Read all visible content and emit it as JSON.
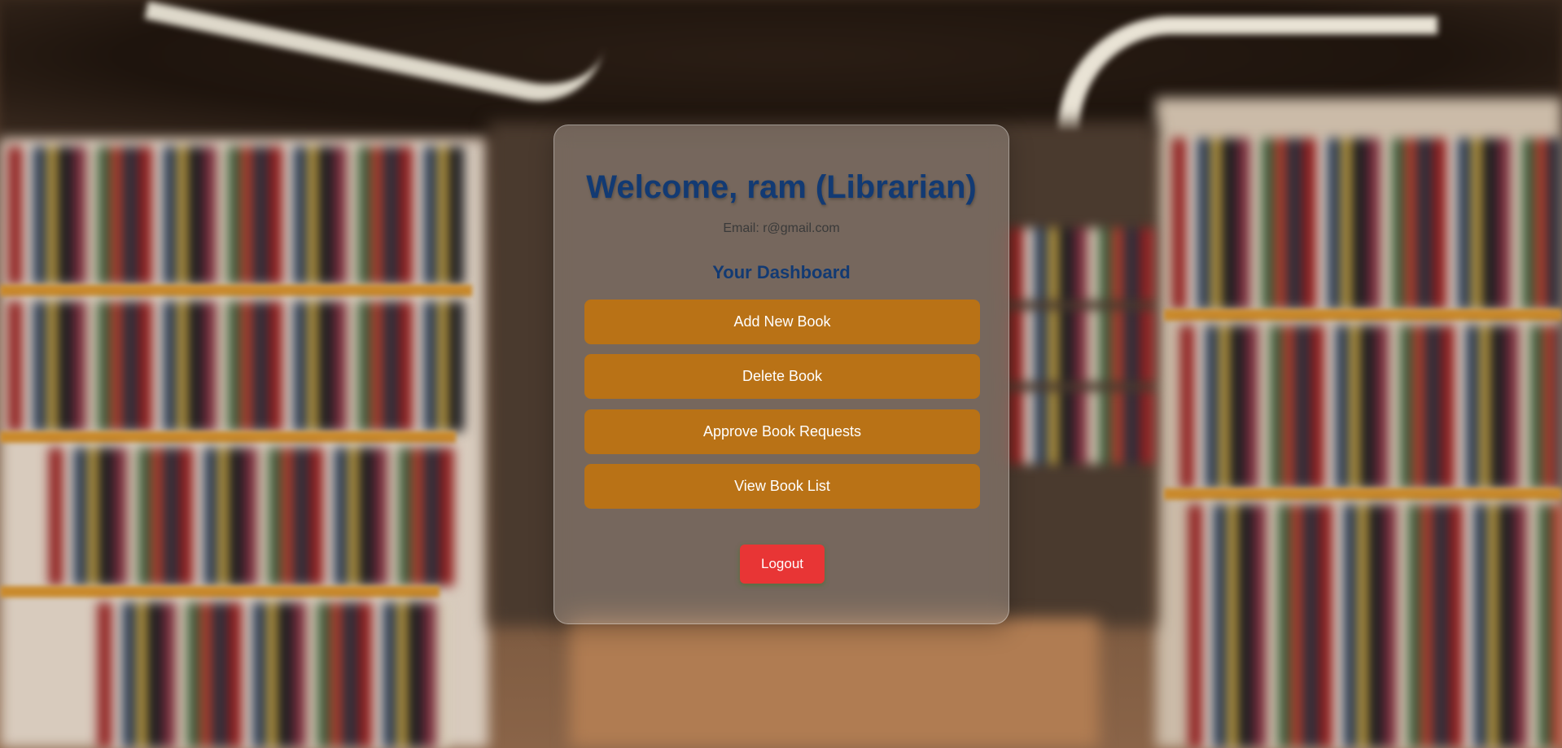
{
  "dashboard": {
    "welcome_title": "Welcome, ram (Librarian)",
    "email_text": "Email: r@gmail.com",
    "section_title": "Your Dashboard",
    "buttons": {
      "add_new_book": "Add New Book",
      "delete_book": "Delete Book",
      "approve_book_requests": "Approve Book Requests",
      "view_book_list": "View Book List"
    },
    "logout_label": "Logout"
  },
  "colors": {
    "title": "#123a73",
    "action_button": "#b97216",
    "logout_button": "#e83535"
  },
  "background": {
    "icon": "blurred-library-bookshelves-background"
  }
}
